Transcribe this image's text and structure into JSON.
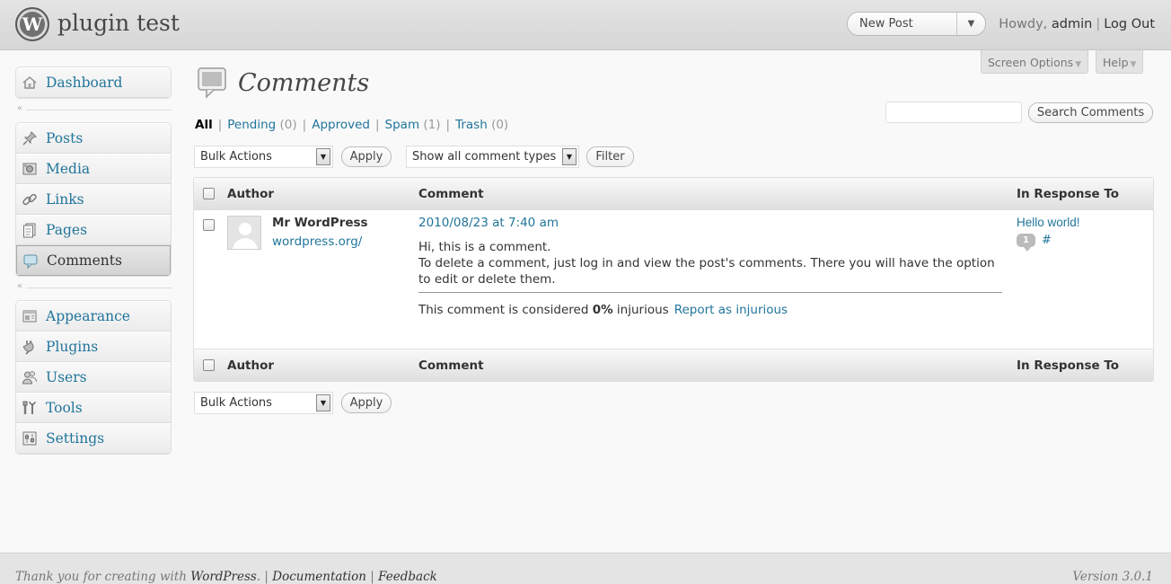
{
  "header": {
    "logo_letter": "W",
    "site_title": "plugin test",
    "favorite_action": "New Post",
    "toggle_arrow": "▼",
    "howdy": "Howdy, ",
    "username": "admin",
    "separator": "|",
    "logout": "Log Out"
  },
  "screen_meta": {
    "screen_options": "Screen Options",
    "help": "Help",
    "arrow": "▼"
  },
  "menu": {
    "collapse_glyph": "«",
    "dashboard": "Dashboard",
    "group1": [
      {
        "label": "Posts",
        "icon": "pin-icon"
      },
      {
        "label": "Media",
        "icon": "media-icon"
      },
      {
        "label": "Links",
        "icon": "link-icon"
      },
      {
        "label": "Pages",
        "icon": "pages-icon"
      },
      {
        "label": "Comments",
        "icon": "comment-icon"
      }
    ],
    "group2": [
      {
        "label": "Appearance",
        "icon": "appearance-icon"
      },
      {
        "label": "Plugins",
        "icon": "plugin-icon"
      },
      {
        "label": "Users",
        "icon": "users-icon"
      },
      {
        "label": "Tools",
        "icon": "tools-icon"
      },
      {
        "label": "Settings",
        "icon": "settings-icon"
      }
    ]
  },
  "page": {
    "title": "Comments"
  },
  "filters": {
    "all": "All",
    "bar": "|",
    "pending": "Pending",
    "pending_count": "(0)",
    "approved": "Approved",
    "spam": "Spam",
    "spam_count": "(1)",
    "trash": "Trash",
    "trash_count": "(0)"
  },
  "search": {
    "placeholder": "",
    "button": "Search Comments"
  },
  "actions": {
    "bulk_label": "Bulk Actions",
    "apply": "Apply",
    "comment_type": "Show all comment types",
    "filter": "Filter",
    "select_arrow": "▼"
  },
  "table": {
    "columns": {
      "author": "Author",
      "comment": "Comment",
      "response": "In Response To"
    },
    "rows": [
      {
        "author_name": "Mr WordPress",
        "author_url": "wordpress.org/",
        "date": "2010/08/23 at 7:40 am",
        "lines": [
          "Hi, this is a comment.",
          "To delete a comment, just log in and view the post's comments. There you will have the option",
          "to edit or delete them."
        ],
        "injury_prefix": "This comment is considered ",
        "injury_value": "0%",
        "injury_suffix": " injurious",
        "report": "Report as injurious",
        "post_title": "Hello world!",
        "comment_count": "1",
        "post_hash": "#"
      }
    ]
  },
  "footer": {
    "thanks": "Thank you for creating with ",
    "wordpress": "WordPress",
    "period": ".",
    "sep": "|",
    "documentation": "Documentation",
    "feedback": "Feedback",
    "version": "Version 3.0.1"
  },
  "colors": {
    "link": "#21759b",
    "header_bg": "#d6d6d6",
    "table_head": "#dfdfdf"
  }
}
